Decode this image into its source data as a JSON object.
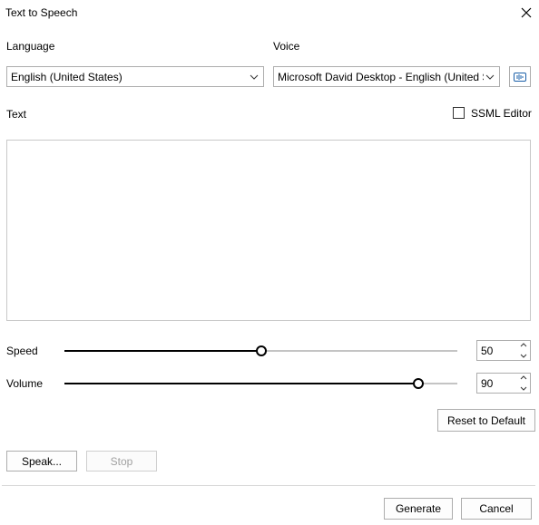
{
  "window": {
    "title": "Text to Speech"
  },
  "language": {
    "label": "Language",
    "selected": "English (United States)"
  },
  "voice": {
    "label": "Voice",
    "selected": "Microsoft David Desktop - English (United S"
  },
  "text": {
    "label": "Text",
    "value": ""
  },
  "ssml": {
    "label": "SSML Editor",
    "checked": false
  },
  "speed": {
    "label": "Speed",
    "value": "50",
    "level_percent": 50
  },
  "volume": {
    "label": "Volume",
    "value": "90",
    "level_percent": 90
  },
  "buttons": {
    "reset": "Reset to Default",
    "speak": "Speak...",
    "stop": "Stop",
    "generate": "Generate",
    "cancel": "Cancel"
  },
  "icons": {
    "close": "close-icon",
    "voice_settings": "voice-settings-icon",
    "chevron": "chevron-down-icon"
  },
  "colors": {
    "slider_fill": "#000000",
    "slider_track": "#c4c4c4"
  }
}
